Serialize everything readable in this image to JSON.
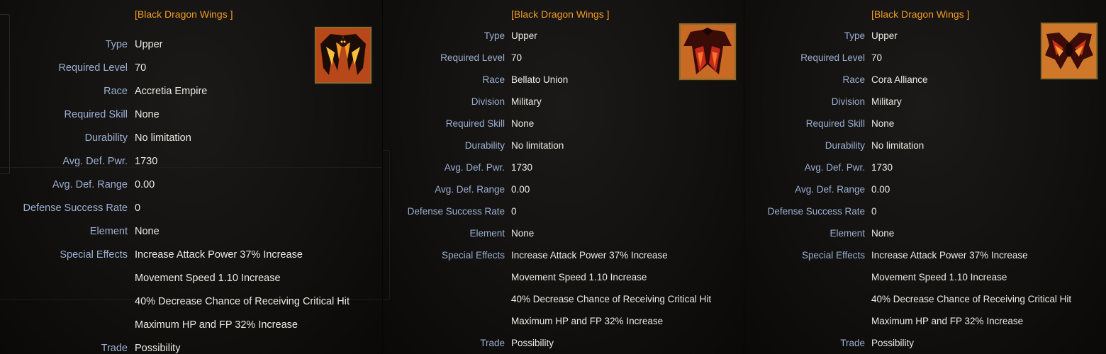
{
  "panels": [
    {
      "title": "[Black Dragon Wings ]",
      "icon": "black-dragon-wings-icon",
      "rows": [
        {
          "label": "Type",
          "value": "Upper"
        },
        {
          "label": "Required Level",
          "value": "70"
        },
        {
          "label": "Race",
          "value": "Accretia Empire"
        },
        {
          "label": "Required Skill",
          "value": "None"
        },
        {
          "label": "Durability",
          "value": "No limitation"
        },
        {
          "label": "Avg. Def. Pwr.",
          "value": "1730"
        },
        {
          "label": "Avg. Def. Range",
          "value": "0.00"
        },
        {
          "label": "Defense Success Rate",
          "value": "0"
        },
        {
          "label": "Element",
          "value": "None"
        },
        {
          "label": "Special Effects",
          "value": "Increase Attack Power 37% Increase"
        },
        {
          "label": "",
          "value": "Movement Speed 1.10 Increase"
        },
        {
          "label": "",
          "value": "40% Decrease Chance of Receiving Critical Hit"
        },
        {
          "label": "",
          "value": "Maximum HP and FP 32% Increase"
        },
        {
          "label": "Trade",
          "value": "Possibility"
        }
      ]
    },
    {
      "title": "[Black Dragon Wings ]",
      "icon": "black-dragon-wings-icon",
      "rows": [
        {
          "label": "Type",
          "value": "Upper"
        },
        {
          "label": "Required Level",
          "value": "70"
        },
        {
          "label": "Race",
          "value": "Bellato Union"
        },
        {
          "label": "Division",
          "value": "Military"
        },
        {
          "label": "Required Skill",
          "value": "None"
        },
        {
          "label": "Durability",
          "value": "No limitation"
        },
        {
          "label": "Avg. Def. Pwr.",
          "value": "1730"
        },
        {
          "label": "Avg. Def. Range",
          "value": "0.00"
        },
        {
          "label": "Defense Success Rate",
          "value": "0"
        },
        {
          "label": "Element",
          "value": "None"
        },
        {
          "label": "Special Effects",
          "value": "Increase Attack Power 37% Increase"
        },
        {
          "label": "",
          "value": "Movement Speed 1.10 Increase"
        },
        {
          "label": "",
          "value": "40% Decrease Chance of Receiving Critical Hit"
        },
        {
          "label": "",
          "value": "Maximum HP and FP 32% Increase"
        },
        {
          "label": "Trade",
          "value": "Possibility"
        }
      ]
    },
    {
      "title": "[Black Dragon Wings ]",
      "icon": "black-dragon-wings-icon",
      "rows": [
        {
          "label": "Type",
          "value": "Upper"
        },
        {
          "label": "Required Level",
          "value": "70"
        },
        {
          "label": "Race",
          "value": "Cora Alliance"
        },
        {
          "label": "Division",
          "value": "Military"
        },
        {
          "label": "Required Skill",
          "value": "None"
        },
        {
          "label": "Durability",
          "value": "No limitation"
        },
        {
          "label": "Avg. Def. Pwr.",
          "value": "1730"
        },
        {
          "label": "Avg. Def. Range",
          "value": "0.00"
        },
        {
          "label": "Defense Success Rate",
          "value": "0"
        },
        {
          "label": "Element",
          "value": "None"
        },
        {
          "label": "Special Effects",
          "value": "Increase Attack Power 37% Increase"
        },
        {
          "label": "",
          "value": "Movement Speed 1.10 Increase"
        },
        {
          "label": "",
          "value": "40% Decrease Chance of Receiving Critical Hit"
        },
        {
          "label": "",
          "value": "Maximum HP and FP 32% Increase"
        },
        {
          "label": "Trade",
          "value": "Possibility"
        }
      ]
    }
  ]
}
